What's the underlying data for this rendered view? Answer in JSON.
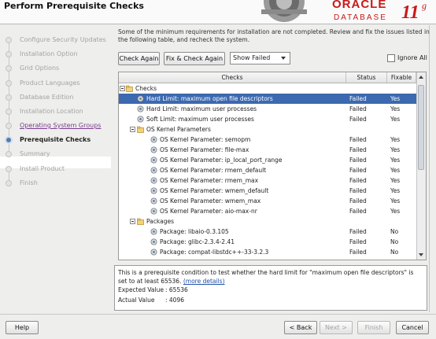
{
  "header": {
    "title": "Perform Prerequisite Checks",
    "brand": "ORACLE",
    "product": "DATABASE",
    "version": "11",
    "version_sup": "g"
  },
  "steps": [
    {
      "label": "Configure Security Updates",
      "state": "disabled"
    },
    {
      "label": "Installation Option",
      "state": "disabled"
    },
    {
      "label": "Grid Options",
      "state": "disabled"
    },
    {
      "label": "Product Languages",
      "state": "disabled"
    },
    {
      "label": "Database Edition",
      "state": "disabled"
    },
    {
      "label": "Installation Location",
      "state": "disabled"
    },
    {
      "label": "Operating System Groups",
      "state": "link"
    },
    {
      "label": "Prerequisite Checks",
      "state": "current"
    },
    {
      "label": "Summary",
      "state": "disabled"
    },
    {
      "label": "Install Product",
      "state": "disabled"
    },
    {
      "label": "Finish",
      "state": "disabled"
    }
  ],
  "intro": "Some of the minimum requirements for installation are not completed. Review and fix the issues listed in the following table, and recheck the system.",
  "toolbar": {
    "check_again": "Check Again",
    "fix_check": "Fix & Check Again",
    "filter_value": "Show Failed",
    "ignore_all": "Ignore All"
  },
  "table": {
    "columns": [
      "Checks",
      "Status",
      "Fixable"
    ],
    "rows": [
      {
        "label": "Checks",
        "type": "group",
        "level": 0
      },
      {
        "label": "Hard Limit: maximum open file descriptors",
        "status": "Failed",
        "fixable": "Yes",
        "level": 1,
        "selected": true
      },
      {
        "label": "Hard Limit: maximum user processes",
        "status": "Failed",
        "fixable": "Yes",
        "level": 1
      },
      {
        "label": "Soft Limit: maximum user processes",
        "status": "Failed",
        "fixable": "Yes",
        "level": 1
      },
      {
        "label": "OS Kernel Parameters",
        "type": "group",
        "level": 1
      },
      {
        "label": "OS Kernel Parameter: semopm",
        "status": "Failed",
        "fixable": "Yes",
        "level": 2
      },
      {
        "label": "OS Kernel Parameter: file-max",
        "status": "Failed",
        "fixable": "Yes",
        "level": 2
      },
      {
        "label": "OS Kernel Parameter: ip_local_port_range",
        "status": "Failed",
        "fixable": "Yes",
        "level": 2
      },
      {
        "label": "OS Kernel Parameter: rmem_default",
        "status": "Failed",
        "fixable": "Yes",
        "level": 2
      },
      {
        "label": "OS Kernel Parameter: rmem_max",
        "status": "Failed",
        "fixable": "Yes",
        "level": 2
      },
      {
        "label": "OS Kernel Parameter: wmem_default",
        "status": "Failed",
        "fixable": "Yes",
        "level": 2
      },
      {
        "label": "OS Kernel Parameter: wmem_max",
        "status": "Failed",
        "fixable": "Yes",
        "level": 2
      },
      {
        "label": "OS Kernel Parameter: aio-max-nr",
        "status": "Failed",
        "fixable": "Yes",
        "level": 2
      },
      {
        "label": "Packages",
        "type": "group",
        "level": 1
      },
      {
        "label": "Package: libaio-0.3.105",
        "status": "Failed",
        "fixable": "No",
        "level": 2
      },
      {
        "label": "Package: glibc-2.3.4-2.41",
        "status": "Failed",
        "fixable": "No",
        "level": 2
      },
      {
        "label": "Package: compat-libstdc++-33-3.2.3",
        "status": "Failed",
        "fixable": "No",
        "level": 2
      }
    ]
  },
  "detail": {
    "text": "This is a prerequisite condition to test whether the hard limit for \"maximum open file descriptors\" is set to at least 65536.",
    "link": "(more details)",
    "expected_label": "Expected Value",
    "expected_value": ": 65536",
    "actual_label": "Actual Value",
    "actual_value": ": 4096"
  },
  "footer": {
    "help": "Help",
    "back": "< Back",
    "next": "Next >",
    "finish": "Finish",
    "cancel": "Cancel"
  },
  "colors": {
    "selection": "#3c69b0",
    "oracle_red": "#c81919",
    "link_visited": "#7a3b8f"
  }
}
